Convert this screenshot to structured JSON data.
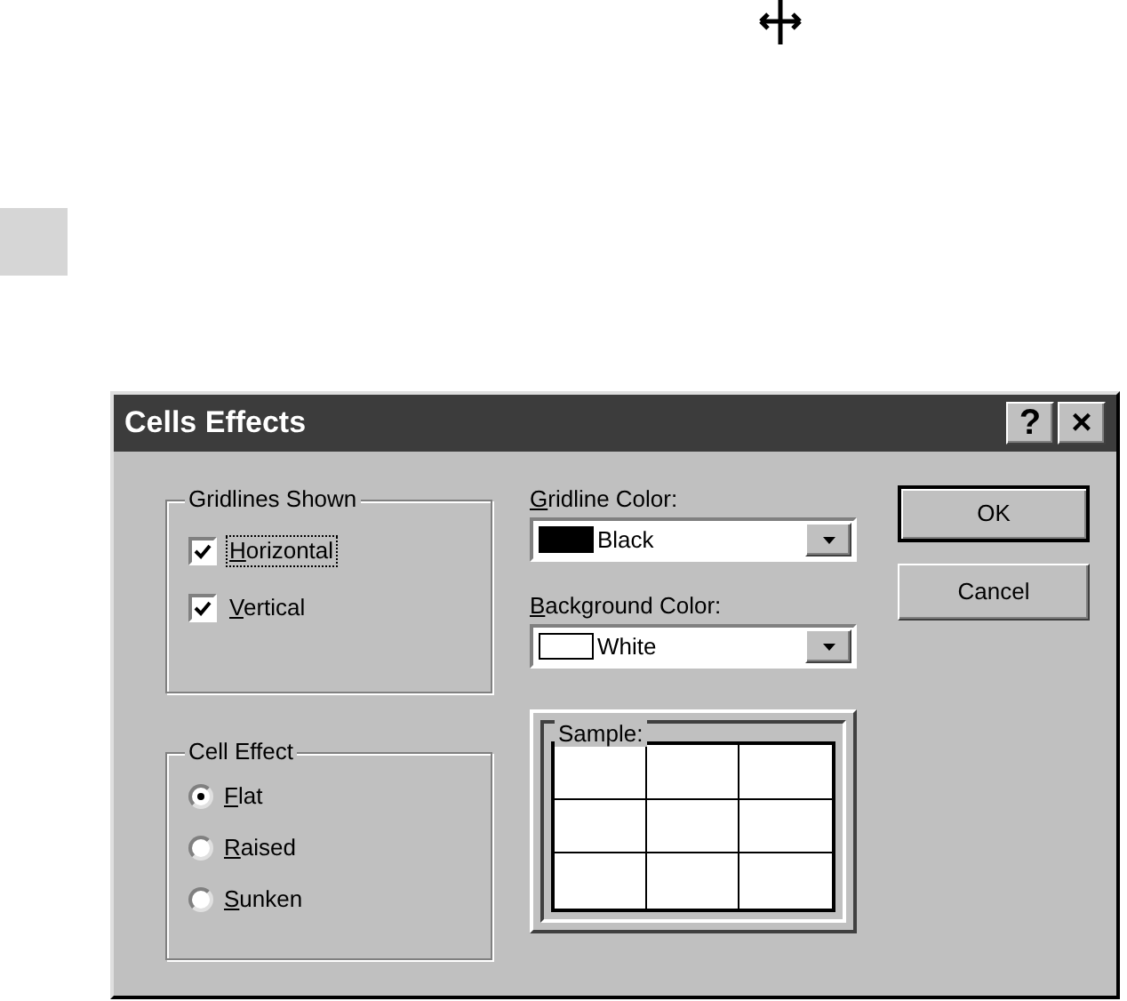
{
  "dialog": {
    "title": "Cells Effects",
    "title_buttons": [
      "?",
      "×"
    ]
  },
  "gridlines_shown": {
    "label": "Gridlines Shown",
    "options": [
      {
        "label": "Horizontal",
        "checked": true,
        "focused": true
      },
      {
        "label": "Vertical",
        "checked": true,
        "focused": false
      }
    ]
  },
  "gridline_color": {
    "label": "Gridline Color:",
    "value": "Black",
    "color": "#000000"
  },
  "background_color": {
    "label": "Background Color:",
    "value": "White",
    "color": "#ffffff"
  },
  "cell_effect": {
    "label": "Cell Effect",
    "options": [
      {
        "label": "Flat",
        "selected": true
      },
      {
        "label": "Raised",
        "selected": false
      },
      {
        "label": "Sunken",
        "selected": false
      }
    ]
  },
  "sample": {
    "label": "Sample:"
  },
  "buttons": [
    "OK",
    "Cancel"
  ]
}
